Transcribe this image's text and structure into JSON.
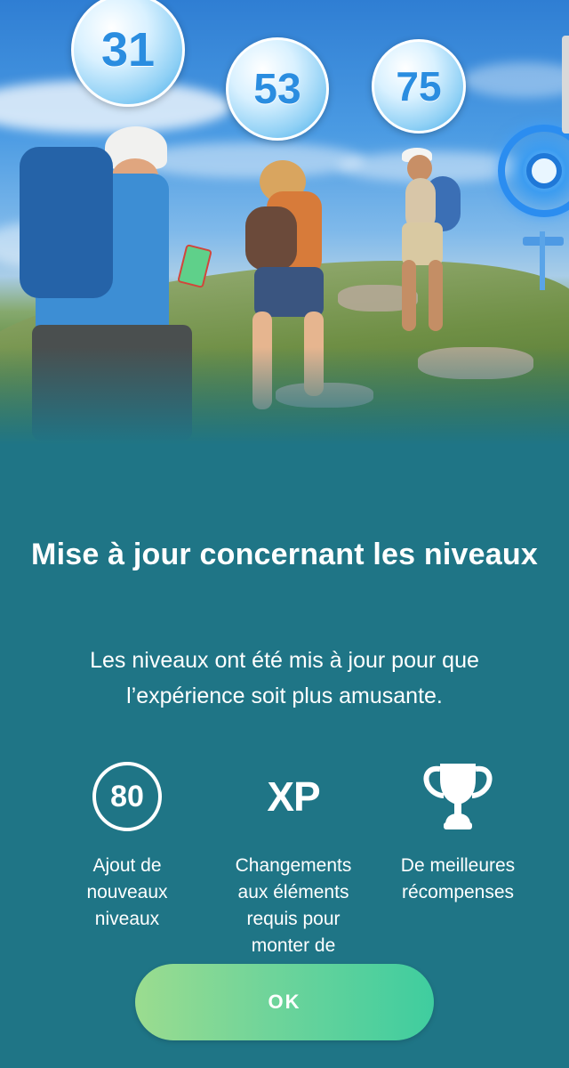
{
  "hero": {
    "level_badges": [
      "31",
      "53",
      "75"
    ],
    "icons": [
      "pokestop-icon"
    ]
  },
  "dialog": {
    "title": "Mise à jour concernant les niveaux",
    "description": "Les niveaux ont été mis à jour pour que\nl’expérience soit plus amusante.",
    "features": [
      {
        "icon": "level-80-icon",
        "icon_text": "80",
        "label": "Ajout de\nnouveaux\nniveaux"
      },
      {
        "icon": "xp-icon",
        "icon_text": "XP",
        "label": "Changements\naux éléments\nrequis pour\nmonter de"
      },
      {
        "icon": "trophy-icon",
        "icon_text": "",
        "label": "De meilleures\nrécompenses"
      }
    ],
    "ok_label": "OK"
  },
  "colors": {
    "background": "#1f7586",
    "button_gradient_start": "#9bdc8f",
    "button_gradient_end": "#3fcd9f",
    "badge_text": "#2a8de0"
  }
}
